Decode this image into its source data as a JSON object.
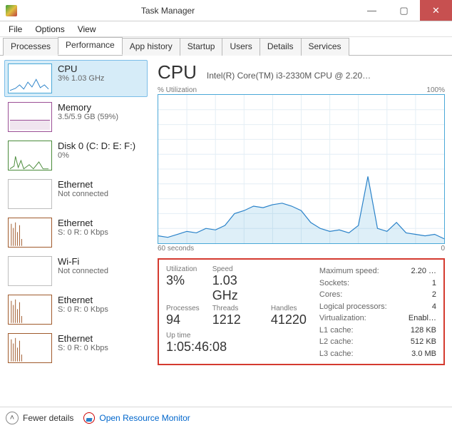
{
  "window": {
    "title": "Task Manager"
  },
  "menu": [
    "File",
    "Options",
    "View"
  ],
  "tabs": [
    "Processes",
    "Performance",
    "App history",
    "Startup",
    "Users",
    "Details",
    "Services"
  ],
  "active_tab": 1,
  "sidebar": [
    {
      "name": "CPU",
      "sub": "3% 1.03 GHz",
      "kind": "cpu",
      "selected": true
    },
    {
      "name": "Memory",
      "sub": "3.5/5.9 GB (59%)",
      "kind": "mem"
    },
    {
      "name": "Disk 0 (C: D: E: F:)",
      "sub": "0%",
      "kind": "disk"
    },
    {
      "name": "Ethernet",
      "sub": "Not connected",
      "kind": "gray"
    },
    {
      "name": "Ethernet",
      "sub": "S: 0 R: 0 Kbps",
      "kind": "eth"
    },
    {
      "name": "Wi-Fi",
      "sub": "Not connected",
      "kind": "gray"
    },
    {
      "name": "Ethernet",
      "sub": "S: 0 R: 0 Kbps",
      "kind": "eth"
    },
    {
      "name": "Ethernet",
      "sub": "S: 0 R: 0 Kbps",
      "kind": "eth"
    }
  ],
  "main": {
    "title": "CPU",
    "model": "Intel(R) Core(TM) i3-2330M CPU @ 2.20…",
    "chart_top_left": "% Utilization",
    "chart_top_right": "100%",
    "chart_bottom_left": "60 seconds",
    "chart_bottom_right": "0"
  },
  "stats": {
    "utilization_label": "Utilization",
    "utilization": "3%",
    "speed_label": "Speed",
    "speed": "1.03 GHz",
    "processes_label": "Processes",
    "processes": "94",
    "threads_label": "Threads",
    "threads": "1212",
    "handles_label": "Handles",
    "handles": "41220",
    "uptime_label": "Up time",
    "uptime": "1:05:46:08",
    "right": [
      {
        "k": "Maximum speed:",
        "v": "2.20 …"
      },
      {
        "k": "Sockets:",
        "v": "1"
      },
      {
        "k": "Cores:",
        "v": "2"
      },
      {
        "k": "Logical processors:",
        "v": "4"
      },
      {
        "k": "Virtualization:",
        "v": "Enabl…"
      },
      {
        "k": "L1 cache:",
        "v": "128 KB"
      },
      {
        "k": "L2 cache:",
        "v": "512 KB"
      },
      {
        "k": "L3 cache:",
        "v": "3.0 MB"
      }
    ]
  },
  "footer": {
    "fewer": "Fewer details",
    "resmon": "Open Resource Monitor"
  },
  "chart_data": {
    "type": "line",
    "title": "CPU % Utilization",
    "xlabel": "seconds ago",
    "ylabel": "% Utilization",
    "ylim": [
      0,
      100
    ],
    "xlim": [
      60,
      0
    ],
    "x": [
      60,
      58,
      56,
      54,
      52,
      50,
      48,
      46,
      44,
      42,
      40,
      38,
      36,
      34,
      32,
      30,
      28,
      26,
      24,
      22,
      20,
      18,
      16,
      14,
      12,
      10,
      8,
      6,
      4,
      2,
      0
    ],
    "values": [
      5,
      4,
      6,
      8,
      7,
      10,
      9,
      12,
      20,
      22,
      25,
      24,
      26,
      27,
      25,
      22,
      14,
      10,
      8,
      9,
      7,
      12,
      45,
      10,
      8,
      14,
      7,
      6,
      5,
      6,
      3
    ]
  }
}
